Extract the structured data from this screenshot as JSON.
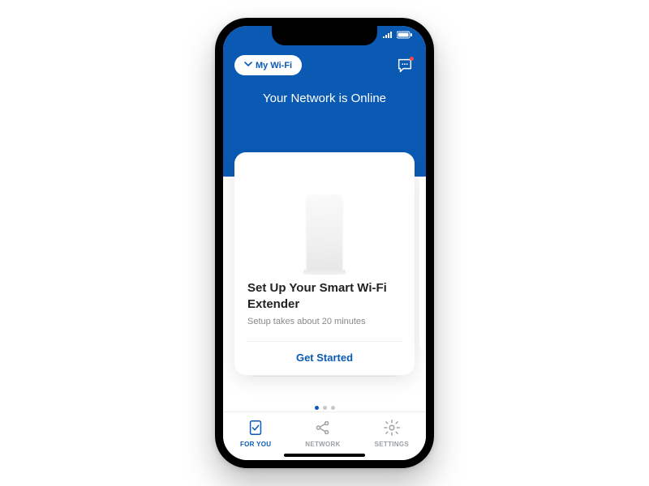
{
  "header": {
    "wifi_pill_label": "My Wi-Fi",
    "status_text": "Your Network is Online"
  },
  "card": {
    "title": "Set Up Your Smart Wi-Fi Extender",
    "subtitle": "Setup takes about 20 minutes",
    "action_label": "Get Started"
  },
  "pager": {
    "count": 3,
    "active_index": 0
  },
  "tabs": [
    {
      "label": "FOR YOU",
      "icon": "check-doc-icon",
      "active": true
    },
    {
      "label": "NETWORK",
      "icon": "network-nodes-icon",
      "active": false
    },
    {
      "label": "SETTINGS",
      "icon": "gear-icon",
      "active": false
    }
  ],
  "colors": {
    "brand": "#0a5ab4",
    "muted": "#9aa0a6"
  }
}
